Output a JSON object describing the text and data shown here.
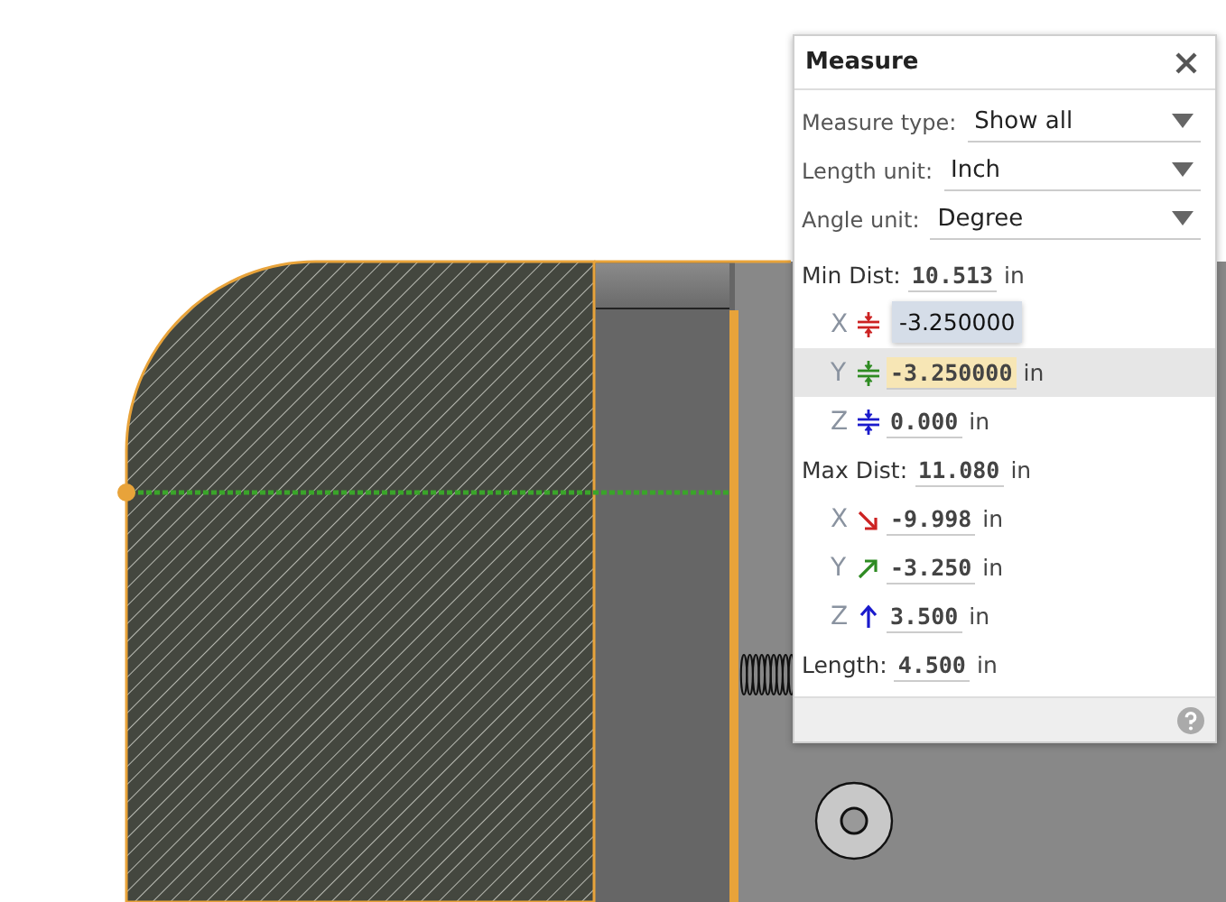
{
  "panel": {
    "title": "Measure",
    "settings": [
      {
        "label": "Measure type:",
        "value": "Show all"
      },
      {
        "label": "Length unit:",
        "value": "Inch"
      },
      {
        "label": "Angle unit:",
        "value": "Degree"
      }
    ],
    "min_dist": {
      "label": "Min Dist:",
      "value": "10.513",
      "unit": "in",
      "components": [
        {
          "axis": "X",
          "kind": "min",
          "color": "#cc2222",
          "tooltip": "-3.250000",
          "selected": false
        },
        {
          "axis": "Y",
          "kind": "min",
          "color": "#2e8b22",
          "value": "-3.250000",
          "unit": "in",
          "selected": true
        },
        {
          "axis": "Z",
          "kind": "min",
          "color": "#1a1acc",
          "value": "0.000",
          "unit": "in",
          "selected": false
        }
      ]
    },
    "max_dist": {
      "label": "Max Dist:",
      "value": "11.080",
      "unit": "in",
      "components": [
        {
          "axis": "X",
          "kind": "down-right",
          "color": "#cc2222",
          "value": "-9.998",
          "unit": "in",
          "selected": false
        },
        {
          "axis": "Y",
          "kind": "up-right",
          "color": "#2e8b22",
          "value": "-3.250",
          "unit": "in",
          "selected": false
        },
        {
          "axis": "Z",
          "kind": "up",
          "color": "#1a1acc",
          "value": "3.500",
          "unit": "in",
          "selected": false
        }
      ]
    },
    "length": {
      "label": "Length:",
      "value": "4.500",
      "unit": "in"
    }
  }
}
